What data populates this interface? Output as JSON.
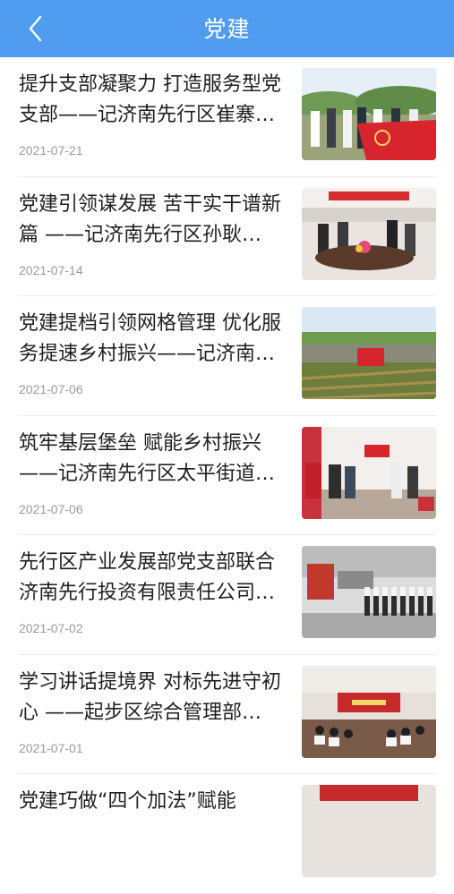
{
  "header": {
    "title": "党建",
    "back_icon": "chevron-left-icon"
  },
  "articles": [
    {
      "title": "提升支部凝聚力 打造服务型党支部——记济南先行区崔寨…",
      "date": "2021-07-21",
      "thumb": "people-with-party-flag-outdoors"
    },
    {
      "title": "党建引领谋发展 苦干实干谱新篇 ——记济南先行区孙耿…",
      "date": "2021-07-14",
      "thumb": "meeting-room-discussion"
    },
    {
      "title": "党建提档引领网格管理 优化服务提速乡村振兴——记济南…",
      "date": "2021-07-06",
      "thumb": "crowd-in-field-with-flag"
    },
    {
      "title": "筑牢基层堡垒 赋能乡村振兴——记济南先行区太平街道孔…",
      "date": "2021-07-06",
      "thumb": "office-visit"
    },
    {
      "title": "先行区产业发展部党支部联合济南先行投资有限责任公司…",
      "date": "2021-07-02",
      "thumb": "group-in-exhibition-hall"
    },
    {
      "title": "学习讲话提境界 对标先进守初心 ——起步区综合管理部…",
      "date": "2021-07-01",
      "thumb": "conference-hall"
    },
    {
      "title": "党建巧做“四个加法”赋能",
      "date": "",
      "thumb": "meeting-photo"
    }
  ]
}
